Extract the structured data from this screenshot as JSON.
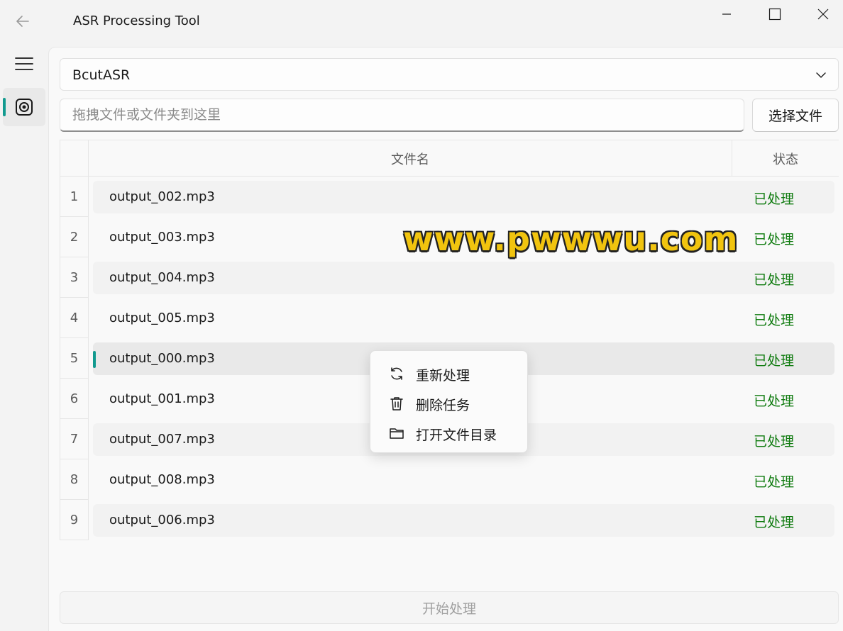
{
  "window": {
    "title": "ASR Processing Tool"
  },
  "asr": {
    "selected_engine": "BcutASR"
  },
  "file_input": {
    "placeholder": "拖拽文件或文件夹到这里",
    "select_button": "选择文件"
  },
  "table": {
    "headers": {
      "name": "文件名",
      "status": "状态"
    },
    "rows": [
      {
        "num": "1",
        "name": "output_002.mp3",
        "status": "已处理"
      },
      {
        "num": "2",
        "name": "output_003.mp3",
        "status": "已处理"
      },
      {
        "num": "3",
        "name": "output_004.mp3",
        "status": "已处理"
      },
      {
        "num": "4",
        "name": "output_005.mp3",
        "status": "已处理"
      },
      {
        "num": "5",
        "name": "output_000.mp3",
        "status": "已处理"
      },
      {
        "num": "6",
        "name": "output_001.mp3",
        "status": "已处理"
      },
      {
        "num": "7",
        "name": "output_007.mp3",
        "status": "已处理"
      },
      {
        "num": "8",
        "name": "output_008.mp3",
        "status": "已处理"
      },
      {
        "num": "9",
        "name": "output_006.mp3",
        "status": "已处理"
      }
    ]
  },
  "context_menu": {
    "items": [
      {
        "label": "重新处理",
        "icon": "refresh-icon"
      },
      {
        "label": "删除任务",
        "icon": "trash-icon"
      },
      {
        "label": "打开文件目录",
        "icon": "folder-icon"
      }
    ]
  },
  "start_button": "开始处理",
  "watermark": "www.pwwwu.com",
  "colors": {
    "accent": "#129a8f",
    "status_done": "#0f7b0f",
    "watermark": "#f1c40f"
  }
}
